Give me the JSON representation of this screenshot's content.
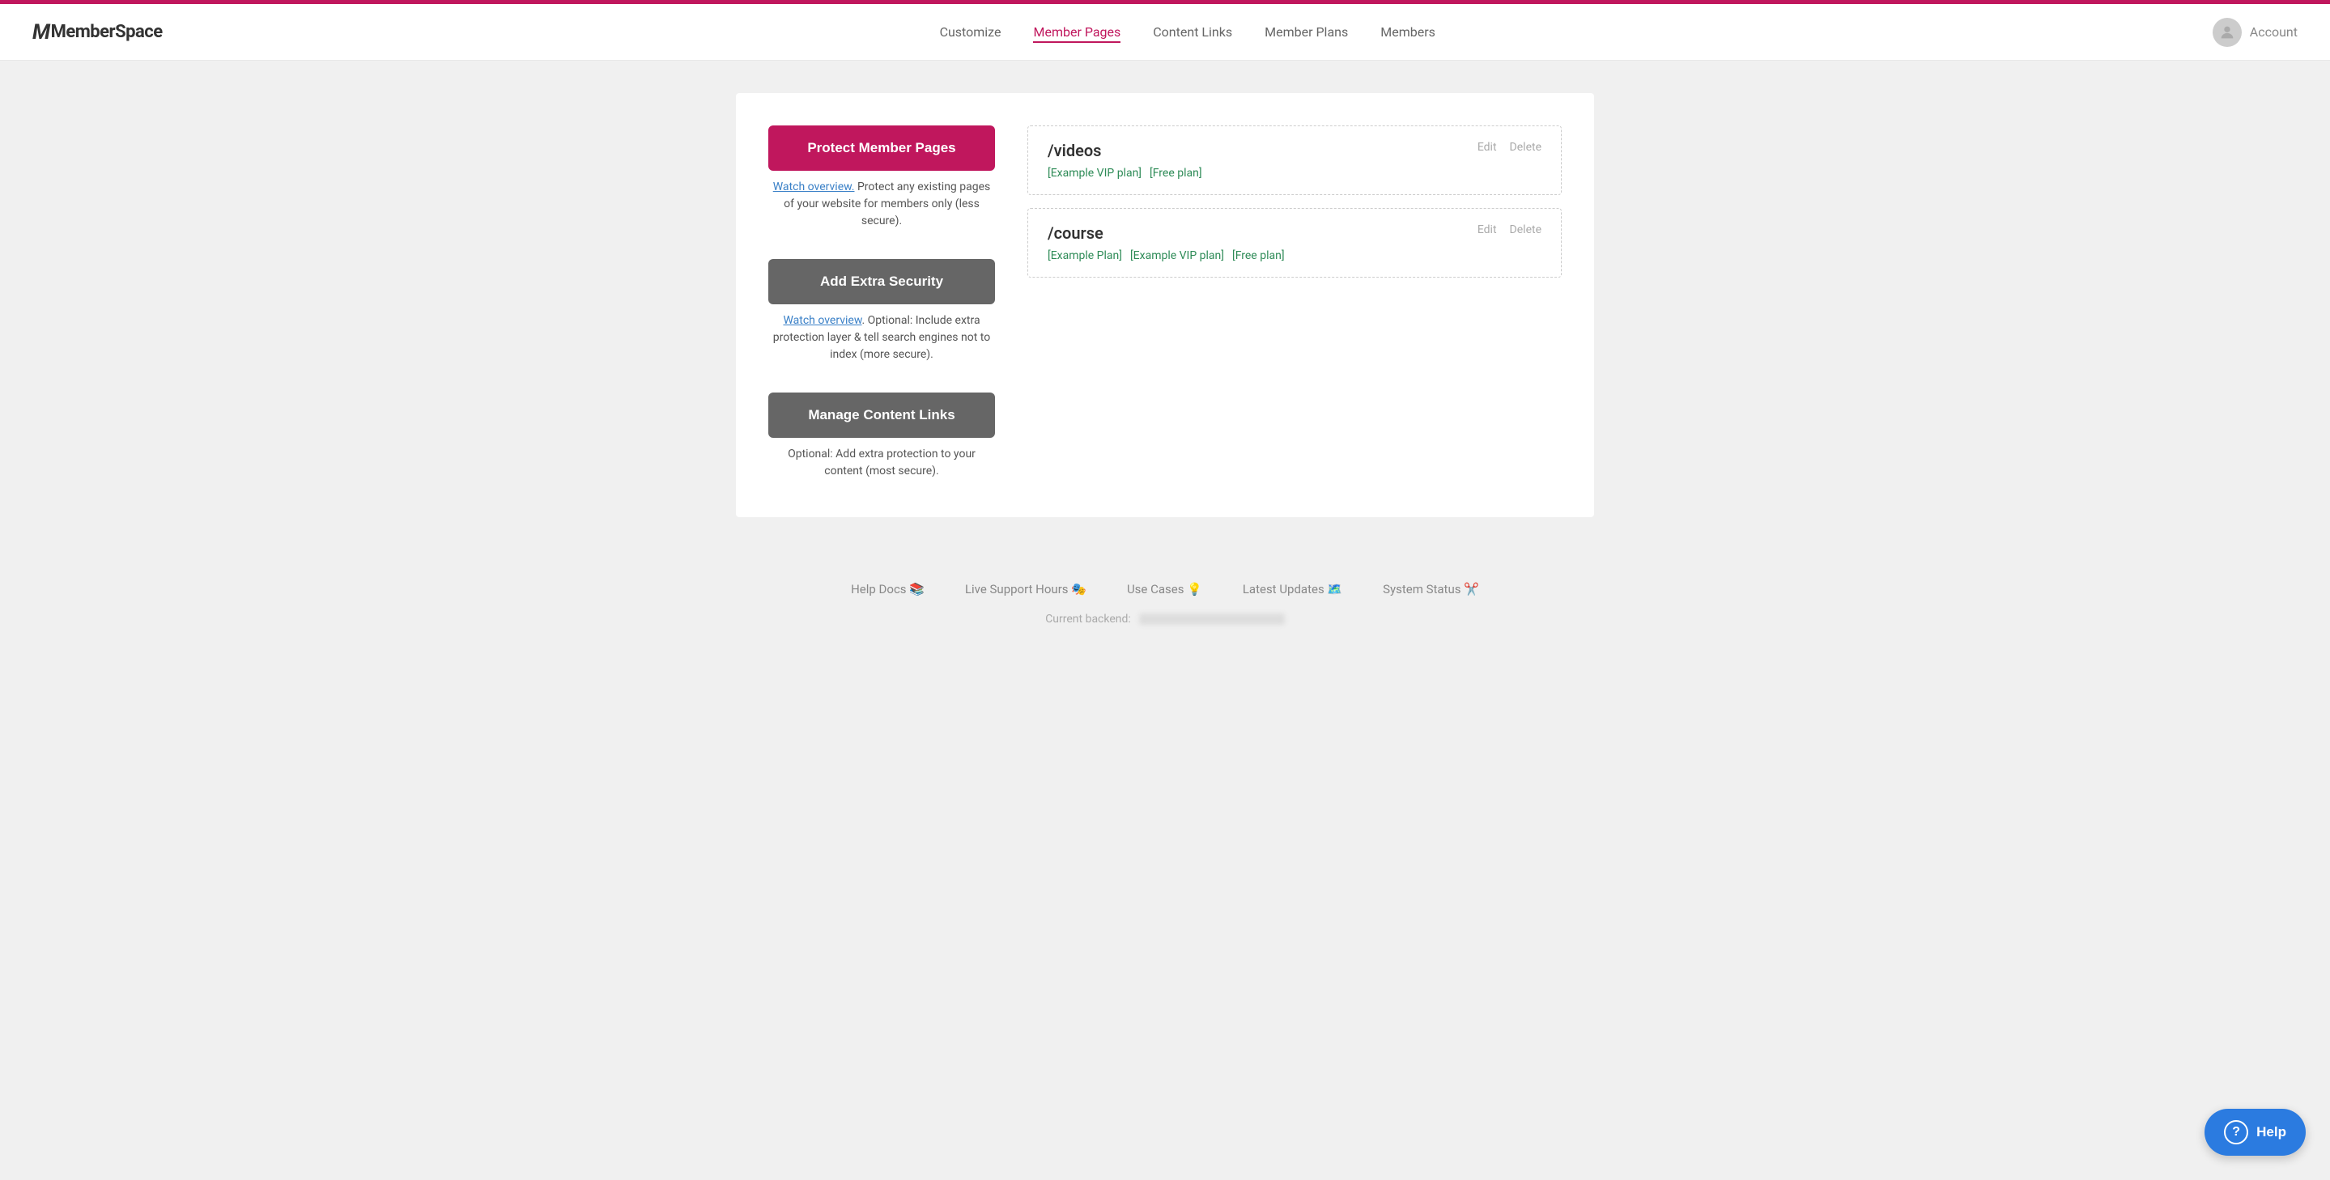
{
  "topBar": {},
  "header": {
    "logo": "MemberSpace",
    "nav": {
      "items": [
        {
          "label": "Customize",
          "active": false
        },
        {
          "label": "Member Pages",
          "active": true
        },
        {
          "label": "Content Links",
          "active": false
        },
        {
          "label": "Member Plans",
          "active": false
        },
        {
          "label": "Members",
          "active": false
        }
      ],
      "account": "Account"
    }
  },
  "sidebar": {
    "btn1_label": "Protect Member Pages",
    "btn1_desc_link": "Watch overview.",
    "btn1_desc": " Protect any existing pages of your website for members only ",
    "btn1_desc_secure": "(less secure)",
    "btn1_desc_end": ".",
    "btn2_label": "Add Extra Security",
    "btn2_desc_link": "Watch overview",
    "btn2_desc": ". Optional: Include extra protection layer & tell search engines not to index ",
    "btn2_desc_secure": "(more secure)",
    "btn2_desc_end": ".",
    "btn3_label": "Manage Content Links",
    "btn3_desc": "Optional: Add extra protection to your content ",
    "btn3_desc_secure": "(most secure)",
    "btn3_desc_end": "."
  },
  "pages": [
    {
      "path": "/videos",
      "plans": [
        "[Example VIP plan]",
        "[Free plan]"
      ],
      "edit": "Edit",
      "delete": "Delete"
    },
    {
      "path": "/course",
      "plans": [
        "[Example Plan]",
        "[Example VIP plan]",
        "[Free plan]"
      ],
      "edit": "Edit",
      "delete": "Delete"
    }
  ],
  "footer": {
    "links": [
      {
        "label": "Help Docs",
        "emoji": "📚"
      },
      {
        "label": "Live Support Hours",
        "emoji": "🎭"
      },
      {
        "label": "Use Cases",
        "emoji": "💡"
      },
      {
        "label": "Latest Updates",
        "emoji": "🗺️"
      },
      {
        "label": "System Status",
        "emoji": "✂️"
      }
    ],
    "backend_label": "Current backend:"
  },
  "help": {
    "label": "Help"
  }
}
